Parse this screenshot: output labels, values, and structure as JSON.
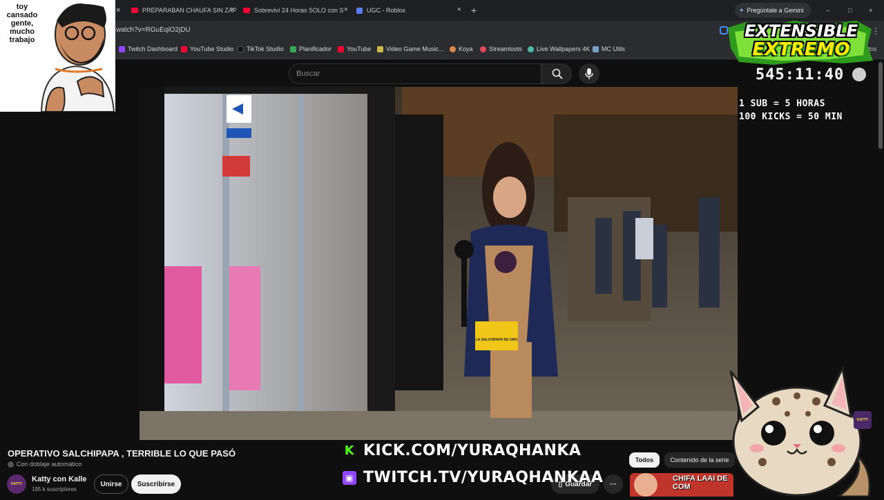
{
  "browser": {
    "tabs": [
      {
        "title": "PREPARABAN CHAUFA SIN ZAP",
        "favicon": "youtube-icon"
      },
      {
        "title": "Sobreviví 24 Horas SOLO con S",
        "favicon": "youtube-icon"
      },
      {
        "title": "UGC - Roblox",
        "favicon": "roblox-icon"
      }
    ],
    "new_tab_label": "+",
    "gemini_label": "Pregúntale a Gemini",
    "url": "watch?v=RGuEqiO2jDU",
    "bookmarks": [
      "Twitch Dashboard",
      "YouTube Studio",
      "TikTok Studio",
      "Planificador",
      "YouTube",
      "Video Game Music...",
      "Koya",
      "Streamloots",
      "Live Wallpapers 4K",
      "MC Utils"
    ],
    "favorites_label": "avoritos"
  },
  "youtube": {
    "search_placeholder": "Buscar",
    "video_title": "OPERATIVO SALCHIPAPA , TERRIBLE LO QUE PASÓ",
    "dubbing_label": "Con doblaje automático",
    "channel_name": "Katty con Kalle",
    "subscribers": "195 k suscriptores",
    "join_label": "Unirse",
    "subscribe_label": "Subscribe",
    "subscribe_text": "Suscribirse",
    "save_label": "Guardar",
    "chips": [
      "Todos",
      "Contenido de la serie"
    ],
    "rec_thumb_text": "CHIFA LAAI DE COM",
    "mic_badge_text": "LA SALCHIPAPA DE ORO"
  },
  "overlay": {
    "meme_text": "toy cansado gente, mucho trabajo",
    "title_line1": "EXTENSIBLE",
    "title_line2": "EXTREMO",
    "timer": "545:11:40",
    "rule1": "1 SUB = 5 HORAS",
    "rule2": "100 KICKS = 50 MIN",
    "kick_url": "KICK.COM/YURAQHANKA",
    "twitch_url": "TWITCH.TV/YURAQHANKAA"
  },
  "colors": {
    "youtube_red": "#ff0033",
    "kick_green": "#53fc18",
    "twitch_purple": "#9146ff",
    "title_yellow": "#ffea00"
  }
}
